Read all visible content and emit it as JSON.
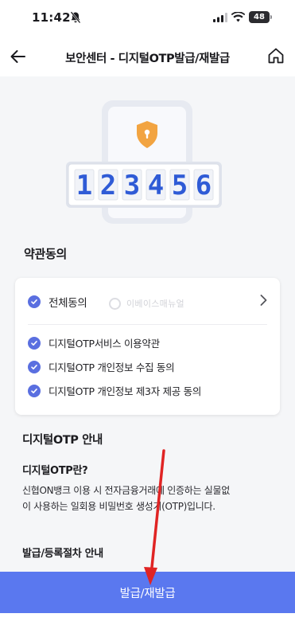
{
  "status_bar": {
    "time": "11:42",
    "battery": "48",
    "icons": [
      "bell-off-icon",
      "signal-icon",
      "wifi-icon",
      "battery-icon"
    ]
  },
  "header": {
    "title": "보안센터 - 디지털OTP발급/재발급",
    "back_icon": "back-arrow-icon",
    "home_icon": "home-icon"
  },
  "otp_illustration": {
    "digits": [
      "1",
      "2",
      "3",
      "4",
      "5",
      "6"
    ],
    "digit_color": "#2f5bd6",
    "badge_icon": "shield-lock-icon",
    "badge_color": "#f2a441"
  },
  "terms": {
    "section_title": "약관동의",
    "all_agree": {
      "label": "전체동의",
      "checked": true
    },
    "items": [
      {
        "label": "디지털OTP서비스 이용약관",
        "checked": true
      },
      {
        "label": "디지털OTP 개인정보 수집 동의",
        "checked": true
      },
      {
        "label": "디지털OTP 개인정보 제3자 제공 동의",
        "checked": true
      }
    ],
    "watermark": "이베이스매뉴얼"
  },
  "info": {
    "heading": "디지털OTP 안내",
    "subheading": "디지털OTP란?",
    "body_line1": "신협ON뱅크 이용 시 전자금융거래에 인증하는 실물없",
    "body_line2": "이 사용하는 일회용 비밀번호 생성기(OTP)입니다.",
    "process_heading": "발급/등록절차 안내"
  },
  "primary_button": {
    "label": "발급/재발급",
    "color": "#5a78ef"
  },
  "colors": {
    "accent": "#5a6fe0",
    "annotation_arrow": "#e02424"
  }
}
